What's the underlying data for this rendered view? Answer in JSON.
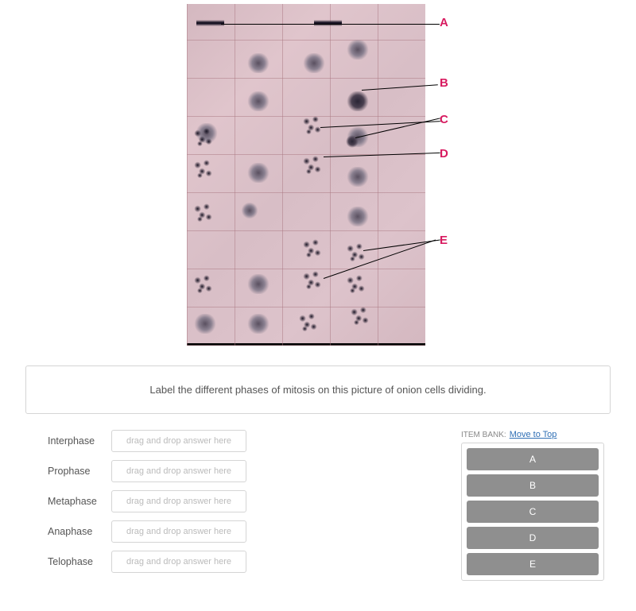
{
  "image": {
    "labels": [
      "A",
      "B",
      "C",
      "D",
      "E"
    ]
  },
  "question": {
    "prompt": "Label the different phases of mitosis on this picture of onion cells dividing."
  },
  "phases": [
    {
      "label": "Interphase",
      "placeholder": "drag and drop answer here"
    },
    {
      "label": "Prophase",
      "placeholder": "drag and drop answer here"
    },
    {
      "label": "Metaphase",
      "placeholder": "drag and drop answer here"
    },
    {
      "label": "Anaphase",
      "placeholder": "drag and drop answer here"
    },
    {
      "label": "Telophase",
      "placeholder": "drag and drop answer here"
    }
  ],
  "item_bank": {
    "title": "ITEM BANK:",
    "link": "Move to Top",
    "items": [
      "A",
      "B",
      "C",
      "D",
      "E"
    ]
  }
}
